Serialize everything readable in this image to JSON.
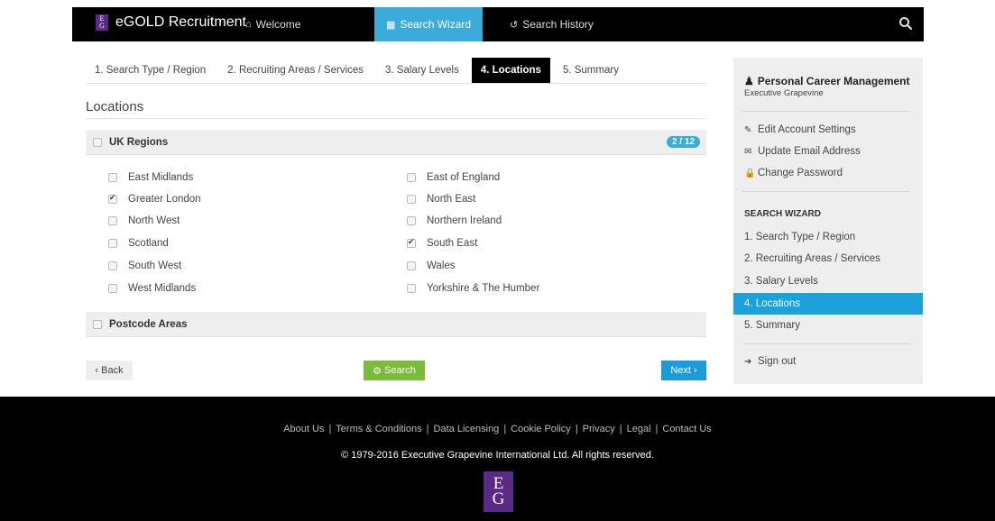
{
  "brand": {
    "name": "eGOLD Recruitment",
    "logo_text": "EG",
    "logo_color": "#5b2a86"
  },
  "nav": {
    "welcome": "Welcome",
    "wizard": "Search Wizard",
    "history": "Search History",
    "active_color": "#3aabdb"
  },
  "tabs": [
    {
      "label": "1. Search Type / Region"
    },
    {
      "label": "2. Recruiting Areas / Services"
    },
    {
      "label": "3. Salary Levels"
    },
    {
      "label": "4. Locations",
      "active": true
    },
    {
      "label": "5. Summary"
    }
  ],
  "page_title": "Locations",
  "uk_regions": {
    "label": "UK Regions",
    "badge": "2 / 12",
    "left": [
      {
        "label": "East Midlands",
        "checked": false
      },
      {
        "label": "Greater London",
        "checked": true
      },
      {
        "label": "North West",
        "checked": false
      },
      {
        "label": "Scotland",
        "checked": false
      },
      {
        "label": "South West",
        "checked": false
      },
      {
        "label": "West Midlands",
        "checked": false
      }
    ],
    "right": [
      {
        "label": "East of England",
        "checked": false
      },
      {
        "label": "North East",
        "checked": false
      },
      {
        "label": "Northern Ireland",
        "checked": false
      },
      {
        "label": "South East",
        "checked": true
      },
      {
        "label": "Wales",
        "checked": false
      },
      {
        "label": "Yorkshire & The Humber",
        "checked": false
      }
    ]
  },
  "postcode": {
    "label": "Postcode Areas"
  },
  "buttons": {
    "back": "‹ Back",
    "search": "Search",
    "next": "Next ›"
  },
  "sidebar": {
    "title": "Personal Career Management",
    "subtitle": "Executive Grapevine",
    "account_links": [
      {
        "label": "Edit Account Settings",
        "icon": "edit-icon"
      },
      {
        "label": "Update Email Address",
        "icon": "envelope-icon"
      },
      {
        "label": "Change Password",
        "icon": "lock-icon"
      }
    ],
    "wizard_heading": "SEARCH WIZARD",
    "steps": [
      {
        "label": "1. Search Type / Region"
      },
      {
        "label": "2. Recruiting Areas / Services"
      },
      {
        "label": "3. Salary Levels"
      },
      {
        "label": "4. Locations",
        "active": true
      },
      {
        "label": "5. Summary"
      }
    ],
    "sign_out": "Sign out"
  },
  "footer": {
    "links": [
      "About Us",
      "Terms & Conditions",
      "Data Licensing",
      "Cookie Policy",
      "Privacy",
      "Legal",
      "Contact Us"
    ],
    "separator": "|",
    "copyright": "© 1979-2016 Executive Grapevine International Ltd. All rights reserved.",
    "logo_text": "EG"
  }
}
